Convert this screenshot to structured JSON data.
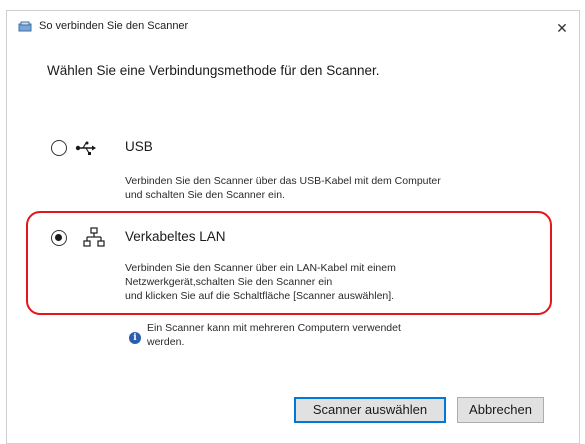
{
  "window": {
    "title": "So verbinden Sie den Scanner",
    "close_glyph": "✕"
  },
  "instruction": "Wählen Sie eine Verbindungsmethode für den Scanner.",
  "options": [
    {
      "label": "USB",
      "description": "Verbinden Sie den Scanner über das USB-Kabel mit dem Computer\nund schalten Sie den Scanner ein.",
      "selected": false,
      "icon": "usb-icon"
    },
    {
      "label": "Verkabeltes LAN",
      "description": "Verbinden Sie den Scanner über ein LAN-Kabel mit einem\nNetzwerkgerät,schalten Sie den Scanner ein\nund klicken Sie auf die Schaltfläche [Scanner auswählen].",
      "selected": true,
      "icon": "wired-lan-icon"
    }
  ],
  "info": {
    "text": "Ein Scanner kann mit mehreren Computern verwendet\nwerden.",
    "glyph": "i"
  },
  "buttons": {
    "select_scanner": "Scanner auswählen",
    "cancel": "Abbrechen"
  },
  "colors": {
    "highlight": "#e3161b",
    "focus": "#0078d7",
    "info": "#2a5db0"
  }
}
